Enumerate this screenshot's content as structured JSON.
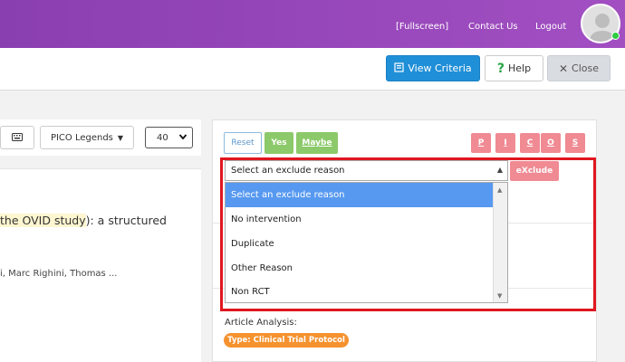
{
  "header": {
    "fullscreen_label": "[Fullscreen]",
    "contact_label": "Contact Us",
    "logout_label": "Logout",
    "status_color": "#2ecc40"
  },
  "actions": {
    "view_criteria_label": "View Criteria",
    "help_label": "Help",
    "close_label": "Close"
  },
  "left_toolbar": {
    "keyboard_icon": "keyboard-icon",
    "pico_legends_label": "PICO Legends",
    "per_page_value": "40"
  },
  "article": {
    "title_line1_prefix": "the OVID study",
    "title_line1_suffix": "): a structured",
    "authors": "i, Marc Righini, Thomas ..."
  },
  "decision": {
    "reset_label": "Reset",
    "yes_label": "Yes",
    "maybe_label": "Maybe",
    "pico_letters": [
      "P",
      "I",
      "C",
      "O",
      "S"
    ],
    "exclude_label": "eXclude"
  },
  "exclude_reason": {
    "selected": "Select an exclude reason",
    "options": [
      "Select an exclude reason",
      "No intervention",
      "Duplicate",
      "Other Reason",
      "Non RCT"
    ]
  },
  "analysis": {
    "label": "Article Analysis:",
    "type_badge": "Type: Clinical Trial Protocol"
  }
}
